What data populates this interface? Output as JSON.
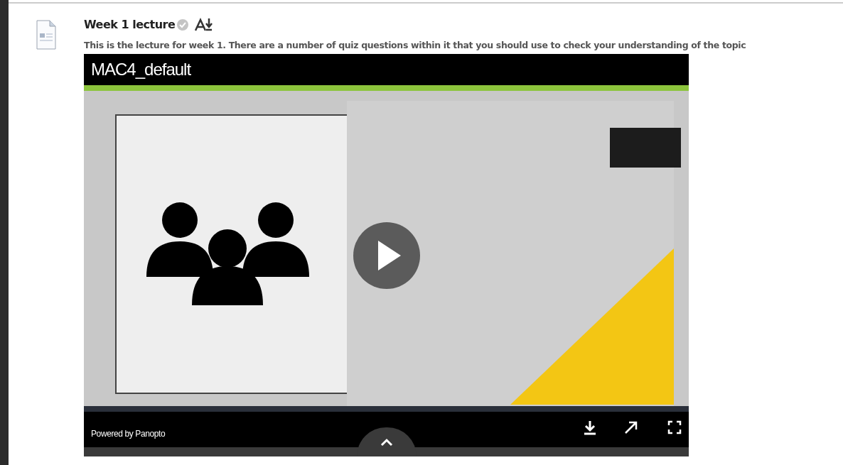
{
  "activity": {
    "title": "Week 1 lecture",
    "completed": false,
    "description": "This is the lecture for week 1. There are a number of quiz questions within it that you should use to check your understanding of the topic"
  },
  "player": {
    "title": "MAC4_default",
    "branding": "Powered by Panopto"
  }
}
